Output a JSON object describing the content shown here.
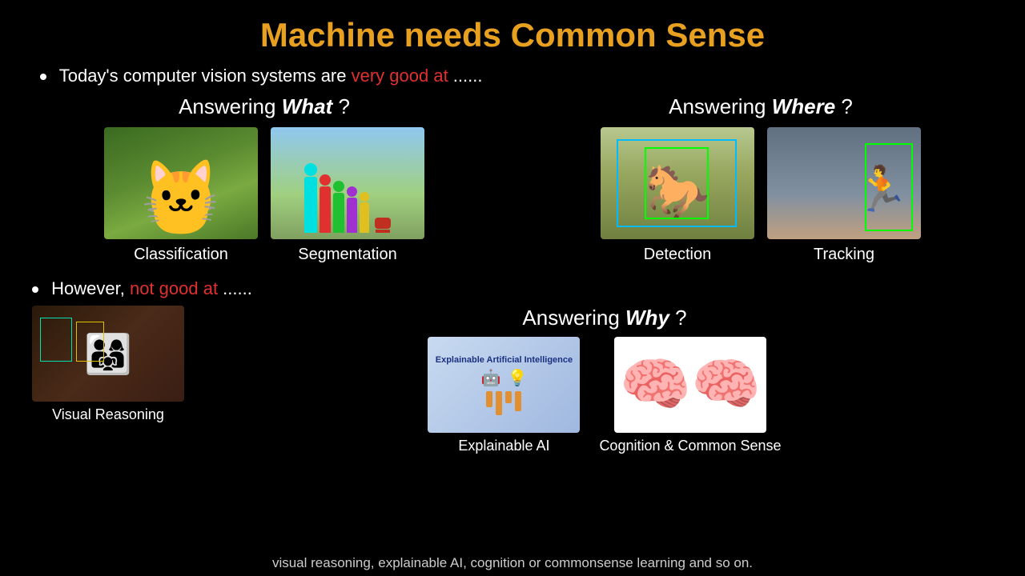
{
  "title": "Machine needs Common Sense",
  "bullet1": {
    "prefix": "Today's computer vision systems are ",
    "highlight": "very good at",
    "suffix": " ......"
  },
  "answering_what": "Answering ",
  "what_italic": "What",
  "what_suffix": " ?",
  "answering_where": "Answering ",
  "where_italic": "Where",
  "where_suffix": " ?",
  "images_top_left": [
    {
      "label": "Classification"
    },
    {
      "label": "Segmentation"
    }
  ],
  "images_top_right": [
    {
      "label": "Detection"
    },
    {
      "label": "Tracking"
    }
  ],
  "bullet2": {
    "prefix": "However, ",
    "highlight": "not good at",
    "suffix": " ......"
  },
  "answering_why": "Answering ",
  "why_italic": "Why",
  "why_suffix": " ?",
  "images_bottom": [
    {
      "label": "Visual Reasoning"
    },
    {
      "label": "Explainable AI"
    },
    {
      "label": "Cognition & Common Sense"
    }
  ],
  "caption": "visual reasoning, explainable AI, cognition or commonsense learning and so on.",
  "xai_title": "Explainable Artificial Intelligence"
}
